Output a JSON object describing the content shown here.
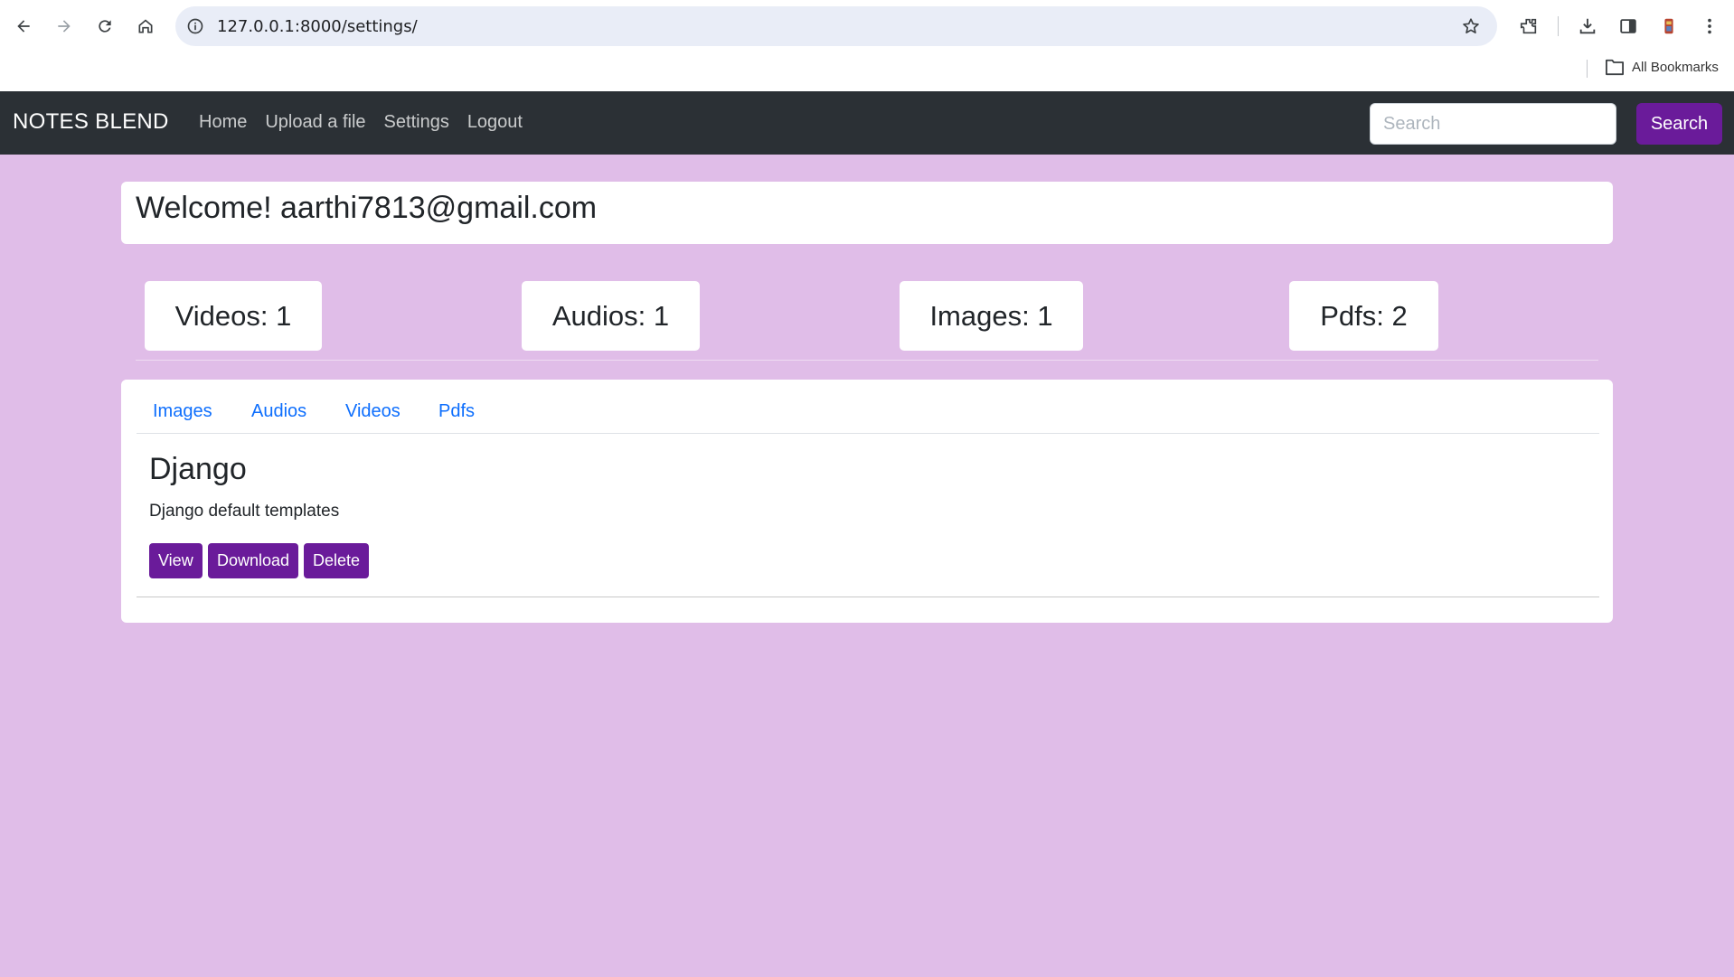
{
  "browser": {
    "url": "127.0.0.1:8000/settings/",
    "bookmarks_label": "All Bookmarks",
    "icons": [
      "back-arrow-icon",
      "forward-arrow-icon",
      "reload-icon",
      "home-icon",
      "site-info-icon",
      "star-icon",
      "extensions-icon",
      "download-icon",
      "side-panel-icon",
      "profile-icon",
      "more-vert-icon",
      "folder-icon"
    ]
  },
  "navbar": {
    "brand": "NOTES BLEND",
    "links": [
      "Home",
      "Upload a file",
      "Settings",
      "Logout"
    ],
    "search_placeholder": "Search",
    "search_button": "Search"
  },
  "welcome": {
    "text": "Welcome! aarthi7813@gmail.com"
  },
  "counts": [
    {
      "label": "Videos: 1"
    },
    {
      "label": "Audios: 1"
    },
    {
      "label": "Images: 1"
    },
    {
      "label": "Pdfs: 2"
    }
  ],
  "files": {
    "tabs": [
      "Images",
      "Audios",
      "Videos",
      "Pdfs"
    ],
    "item": {
      "title": "Django",
      "description": "Django default templates",
      "buttons": [
        "View",
        "Download",
        "Delete"
      ]
    }
  },
  "colors": {
    "page_background": "#e0bde8",
    "navbar": "#2b3035",
    "accent": "#6a1b9a",
    "link": "#0d6efd"
  }
}
